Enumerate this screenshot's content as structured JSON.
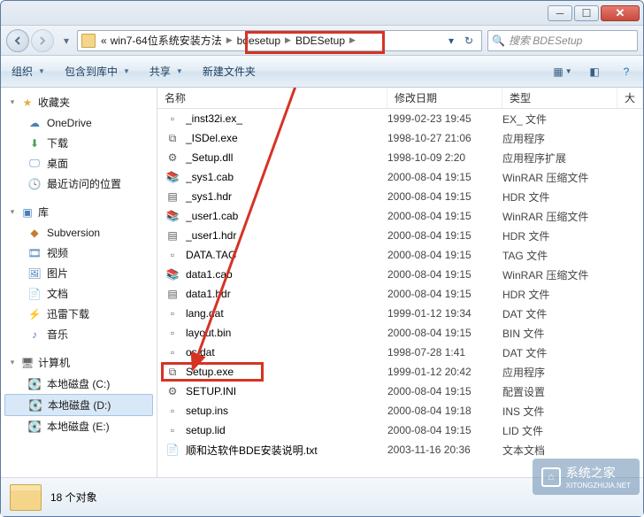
{
  "window": {},
  "address": {
    "prefix_sep": "«",
    "crumb1": "win7-64位系统安装方法",
    "crumb2": "bdesetup",
    "crumb3": "BDESetup"
  },
  "search": {
    "placeholder": "搜索 BDESetup"
  },
  "toolbar": {
    "organize": "组织",
    "include": "包含到库中",
    "share": "共享",
    "newfolder": "新建文件夹"
  },
  "sidebar": {
    "favorites": {
      "label": "收藏夹",
      "items": [
        {
          "label": "OneDrive",
          "icon": "cloud"
        },
        {
          "label": "下载",
          "icon": "dl"
        },
        {
          "label": "桌面",
          "icon": "desk"
        },
        {
          "label": "最近访问的位置",
          "icon": "recent"
        }
      ]
    },
    "libraries": {
      "label": "库",
      "items": [
        {
          "label": "Subversion",
          "icon": "svn"
        },
        {
          "label": "视频",
          "icon": "vid"
        },
        {
          "label": "图片",
          "icon": "pic"
        },
        {
          "label": "文档",
          "icon": "doc"
        },
        {
          "label": "迅雷下载",
          "icon": "thunder"
        },
        {
          "label": "音乐",
          "icon": "music"
        }
      ]
    },
    "computer": {
      "label": "计算机",
      "items": [
        {
          "label": "本地磁盘 (C:)",
          "icon": "drive"
        },
        {
          "label": "本地磁盘 (D:)",
          "icon": "drive",
          "selected": true
        },
        {
          "label": "本地磁盘 (E:)",
          "icon": "drive"
        }
      ]
    }
  },
  "columns": {
    "name": "名称",
    "date": "修改日期",
    "type": "类型",
    "size": "大"
  },
  "files": [
    {
      "name": "_inst32i.ex_",
      "date": "1999-02-23 19:45",
      "type": "EX_ 文件",
      "icon": "dat"
    },
    {
      "name": "_ISDel.exe",
      "date": "1998-10-27 21:06",
      "type": "应用程序",
      "icon": "exe"
    },
    {
      "name": "_Setup.dll",
      "date": "1998-10-09 2:20",
      "type": "应用程序扩展",
      "icon": "dll"
    },
    {
      "name": "_sys1.cab",
      "date": "2000-08-04 19:15",
      "type": "WinRAR 压缩文件",
      "icon": "cab"
    },
    {
      "name": "_sys1.hdr",
      "date": "2000-08-04 19:15",
      "type": "HDR 文件",
      "icon": "hdr"
    },
    {
      "name": "_user1.cab",
      "date": "2000-08-04 19:15",
      "type": "WinRAR 压缩文件",
      "icon": "cab"
    },
    {
      "name": "_user1.hdr",
      "date": "2000-08-04 19:15",
      "type": "HDR 文件",
      "icon": "hdr"
    },
    {
      "name": "DATA.TAG",
      "date": "2000-08-04 19:15",
      "type": "TAG 文件",
      "icon": "dat"
    },
    {
      "name": "data1.cab",
      "date": "2000-08-04 19:15",
      "type": "WinRAR 压缩文件",
      "icon": "cab"
    },
    {
      "name": "data1.hdr",
      "date": "2000-08-04 19:15",
      "type": "HDR 文件",
      "icon": "hdr"
    },
    {
      "name": "lang.dat",
      "date": "1999-01-12 19:34",
      "type": "DAT 文件",
      "icon": "dat"
    },
    {
      "name": "layout.bin",
      "date": "2000-08-04 19:15",
      "type": "BIN 文件",
      "icon": "dat"
    },
    {
      "name": "os.dat",
      "date": "1998-07-28 1:41",
      "type": "DAT 文件",
      "icon": "dat"
    },
    {
      "name": "Setup.exe",
      "date": "1999-01-12 20:42",
      "type": "应用程序",
      "icon": "exe"
    },
    {
      "name": "SETUP.INI",
      "date": "2000-08-04 19:15",
      "type": "配置设置",
      "icon": "ini"
    },
    {
      "name": "setup.ins",
      "date": "2000-08-04 19:18",
      "type": "INS 文件",
      "icon": "dat"
    },
    {
      "name": "setup.lid",
      "date": "2000-08-04 19:15",
      "type": "LID 文件",
      "icon": "dat"
    },
    {
      "name": "顺和达软件BDE安装说明.txt",
      "date": "2003-11-16 20:36",
      "type": "文本文档",
      "icon": "txt"
    }
  ],
  "status": {
    "count": "18 个对象"
  },
  "watermark": {
    "text": "系统之家",
    "sub": "XITONGZHIJIA.NET"
  }
}
